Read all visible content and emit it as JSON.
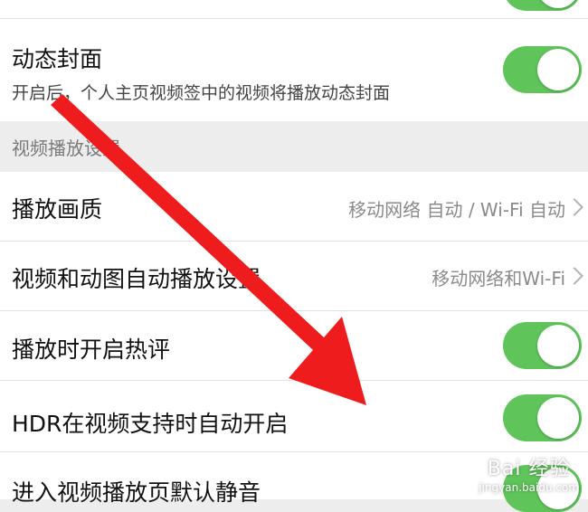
{
  "settings": {
    "dynamic_cover": {
      "title": "动态封面",
      "description": "开启后，个人主页视频签中的视频将播放动态封面",
      "enabled": true
    },
    "section_video_playback": {
      "title": "视频播放设置"
    },
    "playback_quality": {
      "title": "播放画质",
      "value": "移动网络 自动 / Wi-Fi 自动"
    },
    "autoplay": {
      "title": "视频和动图自动播放设置",
      "value": "移动网络和Wi-Fi"
    },
    "hot_comments": {
      "title": "播放时开启热评",
      "enabled": true
    },
    "hdr_auto": {
      "title": "HDR在视频支持时自动开启",
      "enabled": true
    },
    "mute_default": {
      "title": "进入视频播放页默认静音",
      "enabled": true
    }
  },
  "watermark": {
    "brand": "Bai 经验",
    "url": "jingyan.baidu.com"
  },
  "colors": {
    "toggle_on": "#5fc55b",
    "annotation_arrow": "#ee1c1c"
  }
}
